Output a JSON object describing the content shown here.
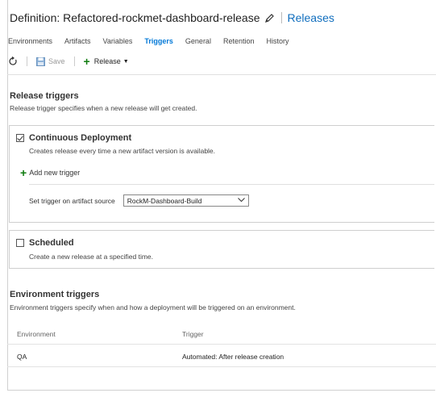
{
  "header": {
    "title": "Definition: Refactored-rockmet-dashboard-release",
    "releases_link": "Releases"
  },
  "tabs": [
    {
      "label": "Environments"
    },
    {
      "label": "Artifacts"
    },
    {
      "label": "Variables"
    },
    {
      "label": "Triggers",
      "active": true
    },
    {
      "label": "General"
    },
    {
      "label": "Retention"
    },
    {
      "label": "History"
    }
  ],
  "toolbar": {
    "refresh_icon": "refresh-icon",
    "save_label": "Save",
    "release_label": "Release"
  },
  "release_triggers": {
    "title": "Release triggers",
    "description": "Release trigger specifies when a new release will get created.",
    "continuous_deployment": {
      "checked": true,
      "label": "Continuous Deployment",
      "description": "Creates release every time a new artifact version is available.",
      "add_trigger_label": "Add new trigger",
      "artifact_source_label": "Set trigger on artifact source",
      "artifact_source_value": "RockM-Dashboard-Build"
    },
    "scheduled": {
      "checked": false,
      "label": "Scheduled",
      "description": "Create a new release at a specified time."
    }
  },
  "environment_triggers": {
    "title": "Environment triggers",
    "description": "Environment triggers specify when and how a deployment will be triggered on an environment.",
    "columns": [
      "Environment",
      "Trigger"
    ],
    "rows": [
      {
        "environment": "QA",
        "trigger": "Automated: After release creation"
      }
    ]
  },
  "colors": {
    "accent": "#0078d7",
    "link": "#106ebe",
    "add_green": "#107c10"
  }
}
